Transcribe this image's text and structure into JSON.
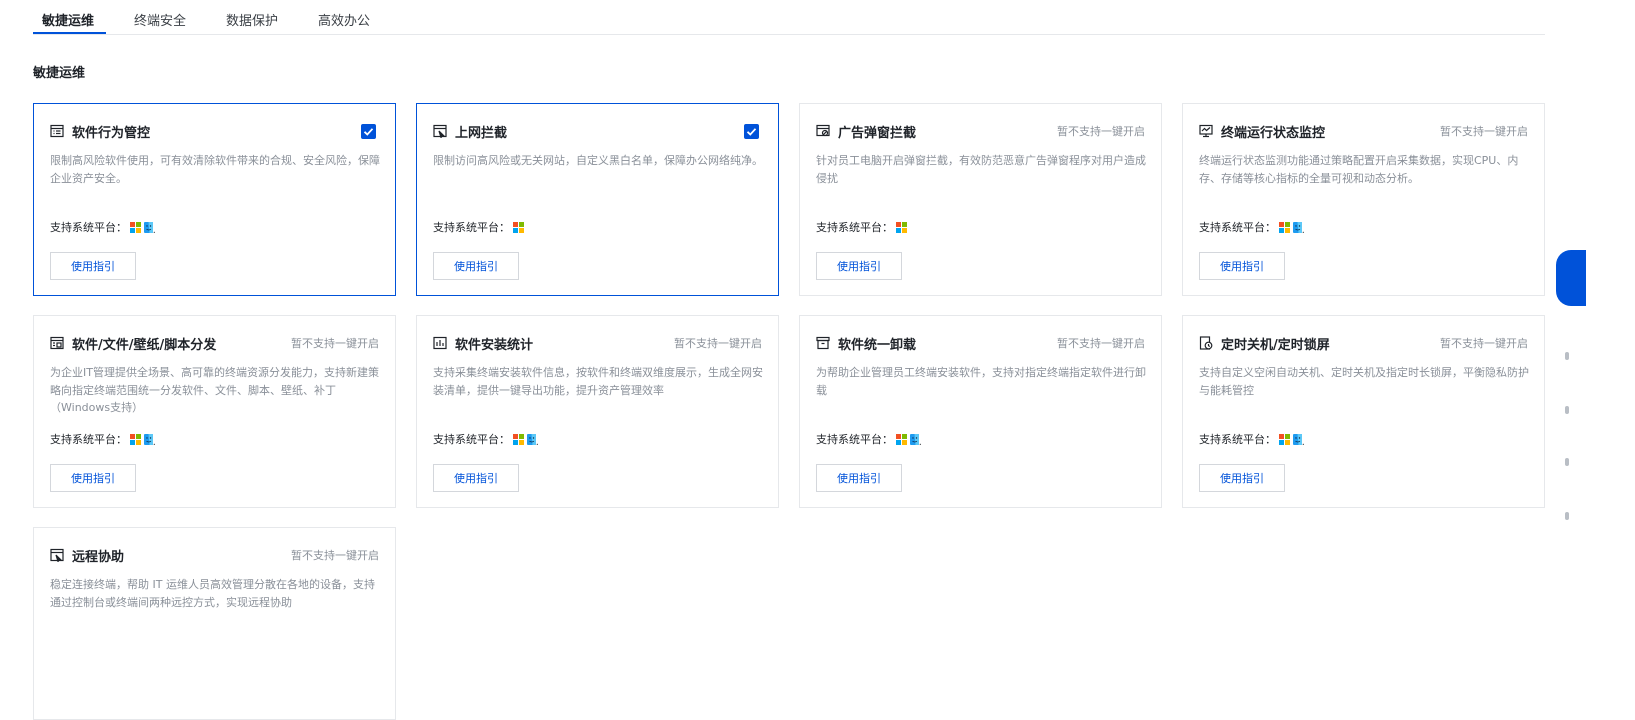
{
  "tabs": [
    {
      "label": "敏捷运维",
      "active": true
    },
    {
      "label": "终端安全",
      "active": false
    },
    {
      "label": "数据保护",
      "active": false
    },
    {
      "label": "高效办公",
      "active": false
    }
  ],
  "section_title": "敏捷运维",
  "platform_label": "支持系统平台：",
  "guide_label": "使用指引",
  "status_unsupported": "暂不支持一键开启",
  "cards": [
    {
      "title": "软件行为管控",
      "desc": "限制高风险软件使用，可有效清除软件带来的合规、安全风险，保障企业资产安全。",
      "checked": true,
      "status": "",
      "platforms": [
        "windows",
        "mac"
      ],
      "icon": "list-icon"
    },
    {
      "title": "上网拦截",
      "desc": "限制访问高风险或无关网站，自定义黑白名单，保障办公网络纯净。",
      "checked": true,
      "status": "",
      "platforms": [
        "windows"
      ],
      "icon": "web-block-icon"
    },
    {
      "title": "广告弹窗拦截",
      "desc": "针对员工电脑开启弹窗拦截，有效防范恶意广告弹窗程序对用户造成侵扰",
      "checked": false,
      "status": "暂不支持一键开启",
      "platforms": [
        "windows"
      ],
      "icon": "popup-block-icon"
    },
    {
      "title": "终端运行状态监控",
      "desc": "终端运行状态监测功能通过策略配置开启采集数据，实现CPU、内存、存储等核心指标的全量可视和动态分析。",
      "checked": false,
      "status": "暂不支持一键开启",
      "platforms": [
        "windows",
        "mac"
      ],
      "icon": "monitor-icon"
    },
    {
      "title": "软件/文件/壁纸/脚本分发",
      "desc": "为企业IT管理提供全场景、高可靠的终端资源分发能力，支持新建策略向指定终端范围统一分发软件、文件、脚本、壁纸、补丁（Windows支持）",
      "checked": false,
      "status": "暂不支持一键开启",
      "platforms": [
        "windows",
        "mac"
      ],
      "icon": "distribute-icon"
    },
    {
      "title": "软件安装统计",
      "desc": "支持采集终端安装软件信息，按软件和终端双维度展示，生成全网安装清单，提供一键导出功能，提升资产管理效率",
      "checked": false,
      "status": "暂不支持一键开启",
      "platforms": [
        "windows",
        "mac"
      ],
      "icon": "stats-icon"
    },
    {
      "title": "软件统一卸载",
      "desc": "为帮助企业管理员工终端安装软件，支持对指定终端指定软件进行卸载",
      "checked": false,
      "status": "暂不支持一键开启",
      "platforms": [
        "windows",
        "mac"
      ],
      "icon": "uninstall-icon"
    },
    {
      "title": "定时关机/定时锁屏",
      "desc": "支持自定义空闲自动关机、定时关机及指定时长锁屏，平衡隐私防护与能耗管控",
      "checked": false,
      "status": "暂不支持一键开启",
      "platforms": [
        "windows",
        "mac"
      ],
      "icon": "timer-icon"
    },
    {
      "title": "远程协助",
      "desc": "稳定连接终端，帮助 IT 运维人员高效管理分散在各地的设备，支持通过控制台或终端间两种远控方式，实现远程协助",
      "checked": false,
      "status": "暂不支持一键开启",
      "platforms": [],
      "icon": "remote-icon"
    }
  ]
}
